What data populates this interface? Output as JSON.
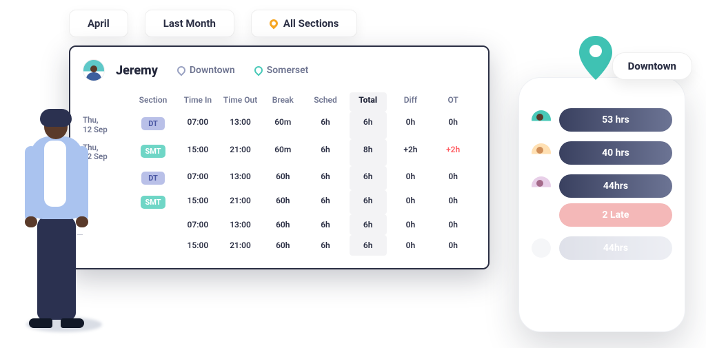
{
  "filters": {
    "month": "April",
    "range": "Last Month",
    "sections": "All Sections"
  },
  "employee": {
    "name": "Jeremy",
    "locations": [
      {
        "label": "Downtown"
      },
      {
        "label": "Somerset"
      }
    ]
  },
  "table": {
    "headers": {
      "section": "Section",
      "time_in": "Time In",
      "time_out": "Time Out",
      "break": "Break",
      "sched": "Sched",
      "total": "Total",
      "diff": "Diff",
      "ot": "OT"
    },
    "rows": [
      {
        "date": "Thu, 12 Sep",
        "section": "DT",
        "section_class": "badge-dt",
        "time_in": "07:00",
        "time_out": "13:00",
        "break": "60m",
        "sched": "6h",
        "total": "6h",
        "diff": "0h",
        "ot": "0h",
        "ot_pos": false
      },
      {
        "date": "Thu, 12 Sep",
        "section": "SMT",
        "section_class": "badge-smt",
        "time_in": "15:00",
        "time_out": "21:00",
        "break": "60m",
        "sched": "6h",
        "total": "8h",
        "diff": "+2h",
        "ot": "+2h",
        "ot_pos": true
      },
      {
        "date": "",
        "section": "DT",
        "section_class": "badge-dt",
        "time_in": "07:00",
        "time_out": "13:00",
        "break": "60h",
        "sched": "6h",
        "total": "6h",
        "diff": "0h",
        "ot": "0h",
        "ot_pos": false
      },
      {
        "date": "",
        "section": "SMT",
        "section_class": "badge-smt",
        "time_in": "15:00",
        "time_out": "21:00",
        "break": "60h",
        "sched": "6h",
        "total": "6h",
        "diff": "0h",
        "ot": "0h",
        "ot_pos": false
      },
      {
        "date": "",
        "section": "",
        "section_class": "",
        "time_in": "07:00",
        "time_out": "13:00",
        "break": "60h",
        "sched": "6h",
        "total": "6h",
        "diff": "0h",
        "ot": "0h",
        "ot_pos": false
      },
      {
        "date": "",
        "section": "",
        "section_class": "",
        "time_in": "15:00",
        "time_out": "21:00",
        "break": "60h",
        "sched": "6h",
        "total": "6h",
        "diff": "0h",
        "ot": "0h",
        "ot_pos": false
      }
    ]
  },
  "phone": {
    "location_label": "Downtown",
    "rows": [
      {
        "hours": "53 hrs",
        "late": ""
      },
      {
        "hours": "40 hrs",
        "late": ""
      },
      {
        "hours": "44hrs",
        "late": "2 Late"
      },
      {
        "hours": "44hrs",
        "late": ""
      }
    ]
  }
}
